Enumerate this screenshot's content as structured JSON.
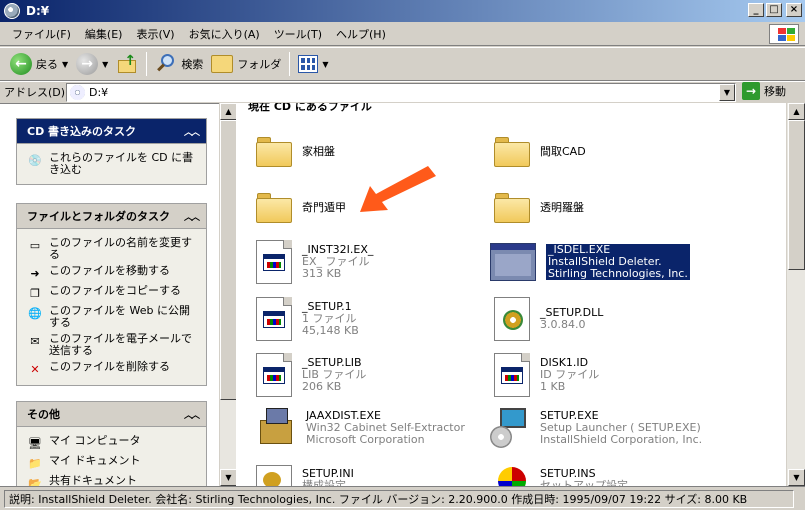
{
  "window": {
    "title": "D:¥"
  },
  "menu": [
    "ファイル(F)",
    "編集(E)",
    "表示(V)",
    "お気に入り(A)",
    "ツール(T)",
    "ヘルプ(H)"
  ],
  "toolbar": {
    "back_label": "戻る",
    "search_label": "検索",
    "folders_label": "フォルダ"
  },
  "address": {
    "label": "アドレス(D)",
    "value": "D:¥",
    "go_label": "移動"
  },
  "tasks": {
    "cd": {
      "title": "CD 書き込みのタスク",
      "items": [
        "これらのファイルを CD に書き込む"
      ]
    },
    "file": {
      "title": "ファイルとフォルダのタスク",
      "items": [
        "このファイルの名前を変更する",
        "このファイルを移動する",
        "このファイルをコピーする",
        "このファイルを Web に公開する",
        "このファイルを電子メールで送信する",
        "このファイルを削除する"
      ]
    },
    "other": {
      "title": "その他",
      "items": [
        "マイ コンピュータ",
        "マイ ドキュメント",
        "共有ドキュメント"
      ]
    }
  },
  "content": {
    "header": "現在 CD にあるファイル",
    "folders": [
      "家相盤",
      "間取CAD",
      "奇門遁甲",
      "透明羅盤"
    ],
    "files": [
      {
        "name": "_INST32I.EX_",
        "type": "EX_ ファイル",
        "size": "313 KB"
      },
      {
        "name": "_ISDEL.EXE",
        "type": "InstallShield Deleter.",
        "size": "Stirling Technologies, Inc."
      },
      {
        "name": "_SETUP.1",
        "type": "1 ファイル",
        "size": "45,148 KB"
      },
      {
        "name": "_SETUP.DLL",
        "type": "3.0.84.0",
        "size": ""
      },
      {
        "name": "_SETUP.LIB",
        "type": "LIB ファイル",
        "size": "206 KB"
      },
      {
        "name": "DISK1.ID",
        "type": "ID ファイル",
        "size": "1 KB"
      },
      {
        "name": "JAAXDIST.EXE",
        "type": "Win32 Cabinet Self-Extractor",
        "size": "Microsoft Corporation"
      },
      {
        "name": "SETUP.EXE",
        "type": "Setup Launcher ( SETUP.EXE)",
        "size": "InstallShield Corporation, Inc."
      },
      {
        "name": "SETUP.INI",
        "type": "構成設定",
        "size": ""
      },
      {
        "name": "SETUP.INS",
        "type": "セットアップ設定",
        "size": ""
      }
    ]
  },
  "status": {
    "text": "説明: InstallShield Deleter. 会社名: Stirling Technologies, Inc. ファイル バージョン: 2.20.900.0 作成日時: 1995/09/07 19:22 サイズ: 8.00 KB"
  },
  "colors": {
    "title_bar": "#0a246a",
    "selection": "#0a246a",
    "arrow": "#ff5a1a",
    "folder": "#f1c95b"
  }
}
